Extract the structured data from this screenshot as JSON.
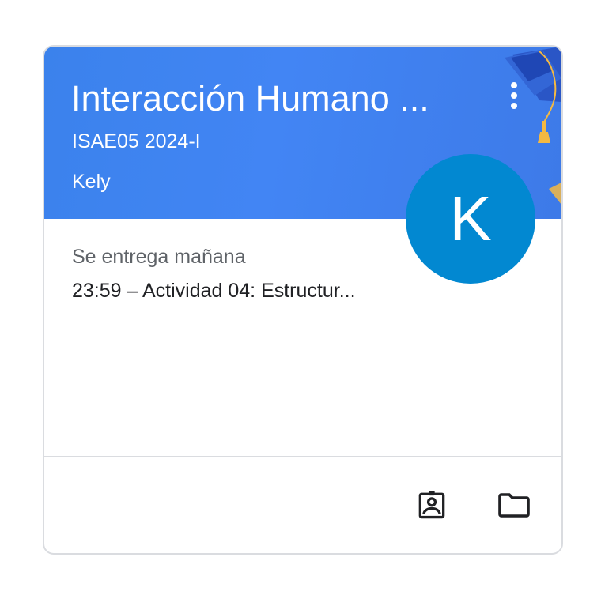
{
  "card": {
    "title": "Interacción Humano ...",
    "section": "ISAE05 2024-I",
    "teacher": "Kely",
    "avatar_letter": "K",
    "due_label": "Se entrega mañana",
    "due_item": "23:59 – Actividad 04: Estructur...",
    "colors": {
      "banner": "#4285f4",
      "avatar": "#0288d1"
    }
  },
  "actions": {
    "work_icon": "assignment-ind-icon",
    "folder_icon": "folder-icon",
    "more_icon": "more-vert-icon"
  }
}
